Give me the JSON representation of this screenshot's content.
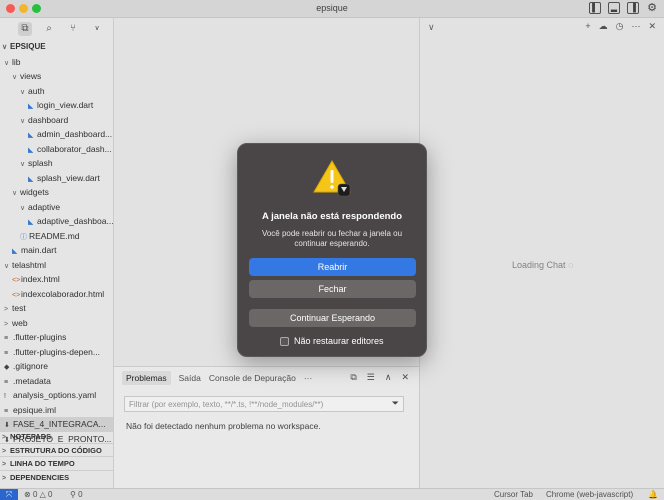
{
  "window": {
    "title": "epsique"
  },
  "explorer": {
    "root": "EPSIQUE",
    "rows": [
      {
        "label": "lib",
        "kind": "folder",
        "indent": 0,
        "chev": "∨"
      },
      {
        "label": "views",
        "kind": "folder",
        "indent": 1,
        "chev": "∨"
      },
      {
        "label": "auth",
        "kind": "folder",
        "indent": 2,
        "chev": "∨"
      },
      {
        "label": "login_view.dart",
        "kind": "dart",
        "indent": 3
      },
      {
        "label": "dashboard",
        "kind": "folder",
        "indent": 2,
        "chev": "∨"
      },
      {
        "label": "admin_dashboard...",
        "kind": "dart",
        "indent": 3
      },
      {
        "label": "collaborator_dash...",
        "kind": "dart",
        "indent": 3
      },
      {
        "label": "splash",
        "kind": "folder",
        "indent": 2,
        "chev": "∨"
      },
      {
        "label": "splash_view.dart",
        "kind": "dart",
        "indent": 3
      },
      {
        "label": "widgets",
        "kind": "folder",
        "indent": 1,
        "chev": "∨"
      },
      {
        "label": "adaptive",
        "kind": "folder",
        "indent": 2,
        "chev": "∨"
      },
      {
        "label": "adaptive_dashboa...",
        "kind": "dart",
        "indent": 3
      },
      {
        "label": "README.md",
        "kind": "info",
        "indent": 2
      },
      {
        "label": "main.dart",
        "kind": "dart",
        "indent": 1
      },
      {
        "label": "telashtml",
        "kind": "folder",
        "indent": 0,
        "chev": "∨"
      },
      {
        "label": "index.html",
        "kind": "html",
        "indent": 1
      },
      {
        "label": "indexcolaborador.html",
        "kind": "html",
        "indent": 1
      },
      {
        "label": "test",
        "kind": "folder",
        "indent": 0,
        "chev": ">"
      },
      {
        "label": "web",
        "kind": "folder",
        "indent": 0,
        "chev": ">"
      },
      {
        "label": ".flutter-plugins",
        "kind": "text",
        "indent": 0
      },
      {
        "label": ".flutter-plugins-depen...",
        "kind": "text",
        "indent": 0
      },
      {
        "label": ".gitignore",
        "kind": "git",
        "indent": 0
      },
      {
        "label": ".metadata",
        "kind": "text",
        "indent": 0
      },
      {
        "label": "analysis_options.yaml",
        "kind": "yaml",
        "indent": 0
      },
      {
        "label": "epsique.iml",
        "kind": "text",
        "indent": 0
      },
      {
        "label": "FASE_4_INTEGRACA...",
        "kind": "md",
        "indent": 0,
        "selected": true
      },
      {
        "label": "PROJETO_E_PRONTO...",
        "kind": "md",
        "indent": 0
      }
    ],
    "sections": [
      "NOTEPADS",
      "ESTRUTURA DO CÓDIGO",
      "LINHA DO TEMPO",
      "DEPENDENCIES"
    ]
  },
  "panel": {
    "tabs": [
      "Problemas",
      "Saída",
      "Console de Depuração",
      "···"
    ],
    "filter_placeholder": "Filtrar (por exemplo, texto, **/*.ts, !**/node_modules/**)",
    "message": "Não foi detectado nenhum problema no workspace."
  },
  "chat": {
    "loading": "Loading Chat"
  },
  "statusbar": {
    "errors": "0",
    "warnings": "0",
    "ports": "0",
    "cursor_tab": "Cursor Tab",
    "device": "Chrome (web-javascript)"
  },
  "dialog": {
    "title": "A janela não está respondendo",
    "message": "Você pode reabrir ou fechar a janela ou continuar esperando.",
    "reopen": "Reabrir",
    "close": "Fechar",
    "keep_waiting": "Continuar Esperando",
    "no_restore": "Não restaurar editores"
  },
  "colors": {
    "accent": "#3478e4",
    "dialog_bg": "#4a4546",
    "warning": "#f5c518"
  }
}
